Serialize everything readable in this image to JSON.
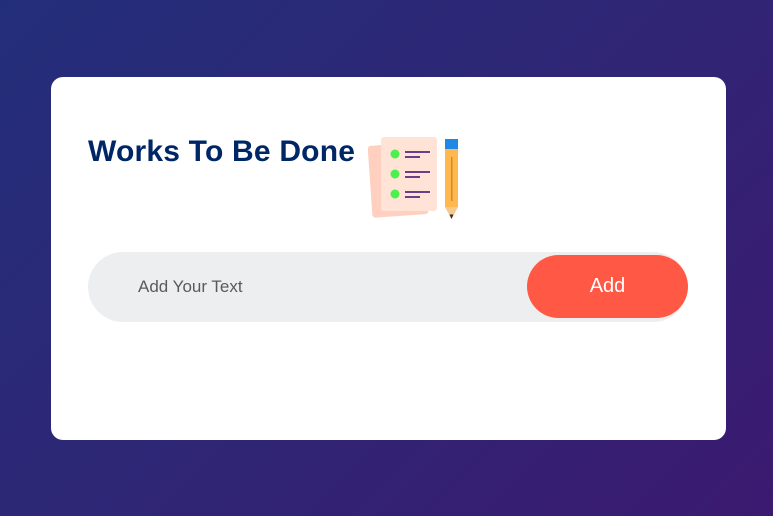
{
  "app": {
    "title": "Works To Be Done",
    "title_icon": "checklist-with-pencil-icon"
  },
  "input": {
    "placeholder": "Add Your Text",
    "value": ""
  },
  "add_button": {
    "label": "Add"
  },
  "colors": {
    "background_gradient": [
      "#232e7a",
      "#3b1a70"
    ],
    "card": "#ffffff",
    "title": "#002765",
    "input_bg": "#edeef0",
    "button": "#ff5945",
    "button_text": "#ffffff"
  }
}
